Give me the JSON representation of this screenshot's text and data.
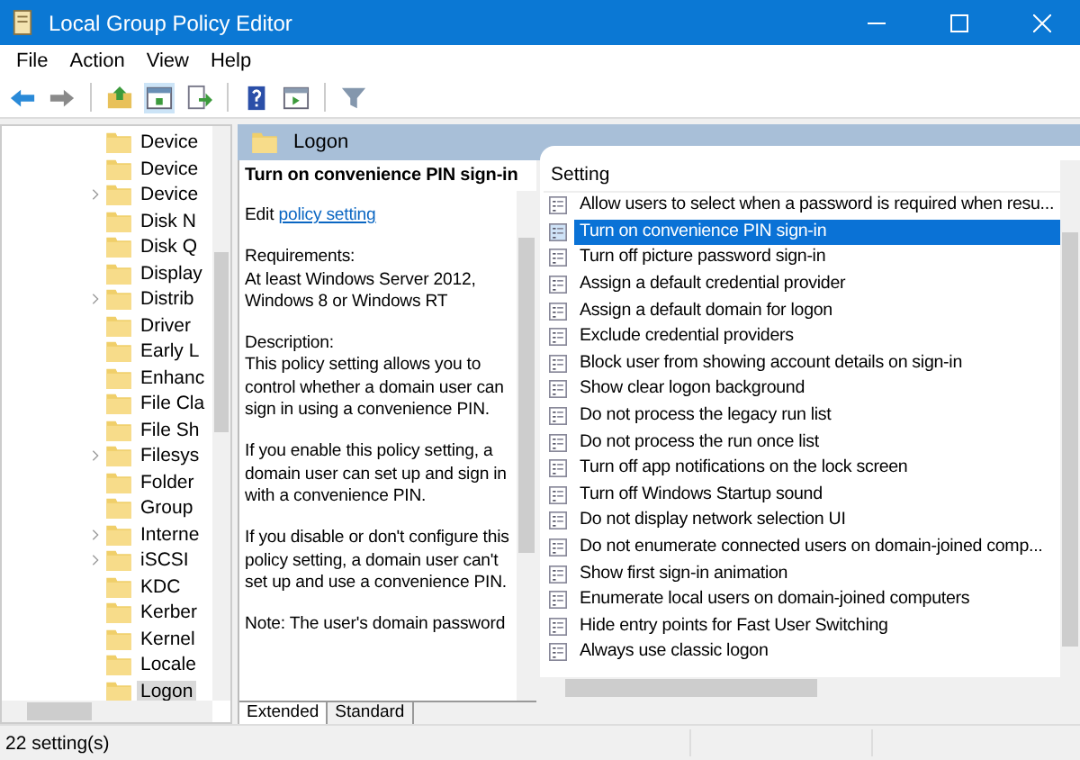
{
  "window": {
    "title": "Local Group Policy Editor"
  },
  "menu": [
    "File",
    "Action",
    "View",
    "Help"
  ],
  "tree": {
    "items": [
      {
        "label": "Device",
        "expander": false,
        "selected": false
      },
      {
        "label": "Device",
        "expander": false,
        "selected": false
      },
      {
        "label": "Device",
        "expander": true,
        "selected": false
      },
      {
        "label": "Disk N",
        "expander": false,
        "selected": false
      },
      {
        "label": "Disk Q",
        "expander": false,
        "selected": false
      },
      {
        "label": "Display",
        "expander": false,
        "selected": false
      },
      {
        "label": "Distrib",
        "expander": true,
        "selected": false
      },
      {
        "label": "Driver",
        "expander": false,
        "selected": false
      },
      {
        "label": "Early L",
        "expander": false,
        "selected": false
      },
      {
        "label": "Enhanc",
        "expander": false,
        "selected": false
      },
      {
        "label": "File Cla",
        "expander": false,
        "selected": false
      },
      {
        "label": "File Sh",
        "expander": false,
        "selected": false
      },
      {
        "label": "Filesys",
        "expander": true,
        "selected": false
      },
      {
        "label": "Folder",
        "expander": false,
        "selected": false
      },
      {
        "label": "Group",
        "expander": false,
        "selected": false
      },
      {
        "label": "Interne",
        "expander": true,
        "selected": false
      },
      {
        "label": "iSCSI",
        "expander": true,
        "selected": false
      },
      {
        "label": "KDC",
        "expander": false,
        "selected": false
      },
      {
        "label": "Kerber",
        "expander": false,
        "selected": false
      },
      {
        "label": "Kernel",
        "expander": false,
        "selected": false
      },
      {
        "label": "Locale",
        "expander": false,
        "selected": false
      },
      {
        "label": "Logon",
        "expander": false,
        "selected": true
      }
    ]
  },
  "folder_header": {
    "title": "Logon"
  },
  "description": {
    "title": "Turn on convenience PIN sign-in",
    "edit": {
      "prefix": "Edit",
      "link": "policy setting"
    },
    "paragraphs": [
      "Requirements:\nAt least Windows Server 2012, Windows 8 or Windows RT",
      "Description:\nThis policy setting allows you to control whether a domain user can sign in using a convenience PIN.",
      "If you enable this policy setting, a domain user can set up and sign in with a convenience PIN.",
      "If you disable or don't configure this policy setting, a domain user can't set up and use a convenience PIN.",
      "Note: The user's domain password"
    ]
  },
  "view_tabs": [
    {
      "label": "Extended",
      "selected": true
    },
    {
      "label": "Standard",
      "selected": false
    }
  ],
  "settings": {
    "column": "Setting",
    "rows": [
      {
        "name": "Allow users to select when a password is required when resu...",
        "selected": false
      },
      {
        "name": "Turn on convenience PIN sign-in",
        "selected": true
      },
      {
        "name": "Turn off picture password sign-in",
        "selected": false
      },
      {
        "name": "Assign a default credential provider",
        "selected": false
      },
      {
        "name": "Assign a default domain for logon",
        "selected": false
      },
      {
        "name": "Exclude credential providers",
        "selected": false
      },
      {
        "name": "Block user from showing account details on sign-in",
        "selected": false
      },
      {
        "name": "Show clear logon background",
        "selected": false
      },
      {
        "name": "Do not process the legacy run list",
        "selected": false
      },
      {
        "name": "Do not process the run once list",
        "selected": false
      },
      {
        "name": "Turn off app notifications on the lock screen",
        "selected": false
      },
      {
        "name": "Turn off Windows Startup sound",
        "selected": false
      },
      {
        "name": "Do not display network selection UI",
        "selected": false
      },
      {
        "name": "Do not enumerate connected users on domain-joined comp...",
        "selected": false
      },
      {
        "name": "Show first sign-in animation",
        "selected": false
      },
      {
        "name": "Enumerate local users on domain-joined computers",
        "selected": false
      },
      {
        "name": "Hide entry points for Fast User Switching",
        "selected": false
      },
      {
        "name": "Always use classic logon",
        "selected": false
      }
    ]
  },
  "status_bar": "22 setting(s)"
}
